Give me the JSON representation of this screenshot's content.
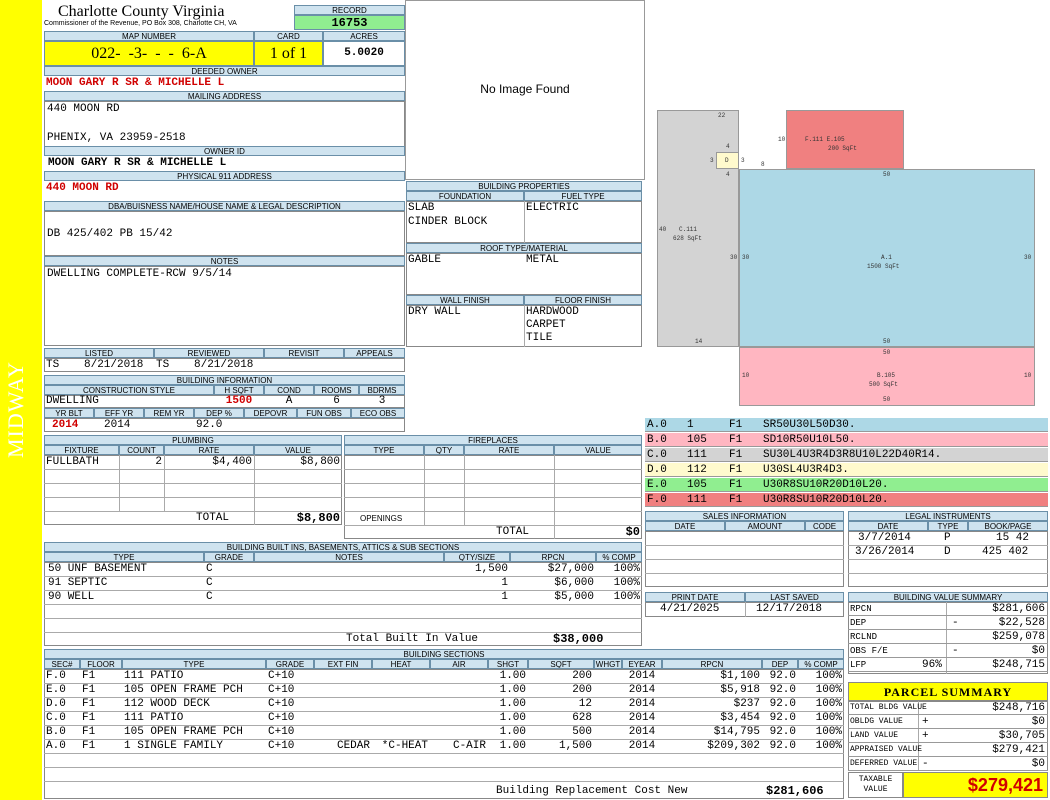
{
  "side_label": "MIDWAY",
  "county": {
    "title": "Charlotte County Virginia",
    "subtitle": "Commissioner of the Revenue, PO Box 308, Charlotte CH, VA"
  },
  "record": {
    "label": "RECORD",
    "value": "16753"
  },
  "map": {
    "label": "MAP NUMBER",
    "value": "022-  -3-  -  -  6-A"
  },
  "card": {
    "label": "CARD",
    "value": "1 of 1"
  },
  "acres": {
    "label": "ACRES",
    "value": "5.0020"
  },
  "deeded_owner": {
    "label": "DEEDED OWNER",
    "value": "MOON GARY R SR & MICHELLE L"
  },
  "mailing": {
    "label": "MAILING ADDRESS",
    "line1": "440 MOON RD",
    "line2": "PHENIX, VA 23959-2518"
  },
  "owner_id": {
    "label": "OWNER ID",
    "value": "MOON GARY R SR & MICHELLE L"
  },
  "physical": {
    "label": "PHYSICAL 911 ADDRESS",
    "value": "440 MOON RD"
  },
  "dba": {
    "label": "DBA/BUISNESS NAME/HOUSE NAME & LEGAL DESCRIPTION",
    "value": "DB 425/402 PB 15/42"
  },
  "notes": {
    "label": "NOTES",
    "value": "DWELLING COMPLETE-RCW 9/5/14"
  },
  "image_placeholder": "No Image Found",
  "listed": {
    "label": "LISTED",
    "by": "TS",
    "date": "8/21/2018"
  },
  "reviewed": {
    "label": "REVIEWED",
    "by": "TS",
    "date": "8/21/2018"
  },
  "revisit": {
    "label": "REVISIT"
  },
  "appeals": {
    "label": "APPEALS"
  },
  "building_info": {
    "label": "BUILDING INFORMATION",
    "h_style": "CONSTRUCTION STYLE",
    "h_sqft": "H SQFT",
    "h_cond": "COND",
    "h_rooms": "ROOMS",
    "h_bdrms": "BDRMS",
    "style": "DWELLING",
    "sqft": "1500",
    "cond": "A",
    "rooms": "6",
    "bdrms": "3",
    "h_yrblt": "YR BLT",
    "h_effyr": "EFF YR",
    "h_remyr": "REM YR",
    "h_dep": "DEP %",
    "h_depovr": "DEPOVR",
    "h_funobs": "FUN OBS",
    "h_ecoobs": "ECO OBS",
    "yrblt": "2014",
    "effyr": "2014",
    "dep": "92.0"
  },
  "building_properties": {
    "label": "BUILDING PROPERTIES",
    "h_foundation": "FOUNDATION",
    "h_fuel": "FUEL TYPE",
    "foundation1": "SLAB",
    "foundation2": "CINDER BLOCK",
    "fuel": "ELECTRIC",
    "h_roof": "ROOF TYPE/MATERIAL",
    "roof_type": "GABLE",
    "roof_material": "METAL",
    "h_wall": "WALL FINISH",
    "h_floor": "FLOOR FINISH",
    "wall": "DRY WALL",
    "floor1": "HARDWOOD",
    "floor2": "CARPET",
    "floor3": "TILE"
  },
  "plumbing": {
    "label": "PLUMBING",
    "h_fixture": "FIXTURE",
    "h_count": "COUNT",
    "h_rate": "RATE",
    "h_value": "VALUE",
    "fixture": "FULLBATH",
    "count": "2",
    "rate": "$4,400",
    "value": "$8,800",
    "total_label": "TOTAL",
    "total": "$8,800"
  },
  "fireplaces": {
    "label": "FIREPLACES",
    "h_type": "TYPE",
    "h_qty": "QTY",
    "h_rate": "RATE",
    "h_value": "VALUE",
    "openings_label": "OPENINGS",
    "total_label": "TOTAL",
    "total": "$0"
  },
  "sketch": {
    "n22": "22",
    "n10a": "10",
    "n4a": "4",
    "n3a": "3",
    "n3b": "3",
    "n8": "8",
    "n4b": "4",
    "box_d": "D",
    "f_label": "F.111  E.105",
    "f_sqft": "200 SqFt",
    "n50a": "50",
    "n40": "40",
    "n30a": "30",
    "n30b": "30",
    "n30c": "30",
    "c_label": "C.111",
    "c_sqft": "628 SqFt",
    "a_label": "A.1",
    "a_sqft": "1500 SqFt",
    "n14": "14",
    "n50b": "50",
    "n50c": "50",
    "n10b": "10",
    "n10c": "10",
    "b_label": "B.105",
    "b_sqft": "500 SqFt",
    "n50d": "50"
  },
  "legend_rows": [
    {
      "code": "A.0",
      "num": "1",
      "floor": "F1",
      "path": "SR50U30L50D30.",
      "color": "#add8e6"
    },
    {
      "code": "B.0",
      "num": "105",
      "floor": "F1",
      "path": "SD10R50U10L50.",
      "color": "#ffb6c1"
    },
    {
      "code": "C.0",
      "num": "111",
      "floor": "F1",
      "path": "SU30L4U3R4D3R8U10L22D40R14.",
      "color": "#d3d3d3"
    },
    {
      "code": "D.0",
      "num": "112",
      "floor": "F1",
      "path": "U30SL4U3R4D3.",
      "color": "#fffacd"
    },
    {
      "code": "E.0",
      "num": "105",
      "floor": "F1",
      "path": "U30R8SU10R20D10L20.",
      "color": "#90ee90"
    },
    {
      "code": "F.0",
      "num": "111",
      "floor": "F1",
      "path": "U30R8SU10R20D10L20.",
      "color": "#f08080"
    }
  ],
  "sales": {
    "label": "SALES INFORMATION",
    "h_date": "DATE",
    "h_amount": "AMOUNT",
    "h_code": "CODE"
  },
  "legal": {
    "label": "LEGAL INSTRUMENTS",
    "h_date": "DATE",
    "h_type": "TYPE",
    "h_book": "BOOK/PAGE",
    "rows": [
      {
        "date": "3/7/2014",
        "type": "P",
        "book": "15 42"
      },
      {
        "date": "3/26/2014",
        "type": "D",
        "book": "425 402"
      }
    ]
  },
  "print_date": {
    "label": "PRINT DATE",
    "value": "4/21/2025"
  },
  "last_saved": {
    "label": "LAST SAVED",
    "value": "12/17/2018"
  },
  "bvs": {
    "label": "BUILDING VALUE SUMMARY",
    "rpcn_l": "RPCN",
    "rpcn": "$281,606",
    "dep_l": "DEP",
    "dep_sign": "-",
    "dep": "$22,528",
    "rclnd_l": "RCLND",
    "rclnd": "$259,078",
    "obs_l": "OBS F/E",
    "obs_sign": "-",
    "obs": "$0",
    "lfr_l": "LFP",
    "lfr_pct": "96%",
    "lfr": "$248,715"
  },
  "parcel": {
    "label": "PARCEL SUMMARY",
    "bldg_l": "TOTAL BLDG VALUE",
    "bldg": "$248,716",
    "obldg_l": "OBLDG VALUE",
    "obldg_sign": "+",
    "obldg": "$0",
    "land_l": "LAND VALUE",
    "land_sign": "+",
    "land": "$30,705",
    "appr_l": "APPRAISED VALUE",
    "appr": "$279,421",
    "def_l": "DEFERRED VALUE",
    "def_sign": "-",
    "def": "$0",
    "tax_l1": "TAXABLE",
    "tax_l2": "VALUE",
    "tax": "$279,421"
  },
  "built_ins": {
    "label": "BUILDING BUILT INS, BASEMENTS, ATTICS & SUB SECTIONS",
    "h_type": "TYPE",
    "h_grade": "GRADE",
    "h_notes": "NOTES",
    "h_qty": "QTY/SIZE",
    "h_rpcn": "RPCN",
    "h_comp": "% COMP",
    "rows": [
      {
        "type": "50 UNF BASEMENT",
        "grade": "C",
        "qty": "1,500",
        "rpcn": "$27,000",
        "comp": "100%"
      },
      {
        "type": "91 SEPTIC",
        "grade": "C",
        "qty": "1",
        "rpcn": "$6,000",
        "comp": "100%"
      },
      {
        "type": "90 WELL",
        "grade": "C",
        "qty": "1",
        "rpcn": "$5,000",
        "comp": "100%"
      }
    ],
    "total_label": "Total Built In Value",
    "total": "$38,000"
  },
  "sections": {
    "label": "BUILDING SECTIONS",
    "h_sec": "SEC#",
    "h_floor": "FLOOR",
    "h_type": "TYPE",
    "h_grade": "GRADE",
    "h_extfin": "EXT FIN",
    "h_heat": "HEAT",
    "h_air": "AIR",
    "h_shgt": "SHGT",
    "h_sqft": "SQFT",
    "h_whgt": "WHGT",
    "h_eyear": "EYEAR",
    "h_rpcn": "RPCN",
    "h_dep": "DEP",
    "h_comp": "% COMP",
    "rows": [
      {
        "sec": "F.0",
        "floor": "F1",
        "type": "111 PATIO",
        "grade": "C+10",
        "extfin": "",
        "heat": "",
        "air": "",
        "shgt": "1.00",
        "sqft": "200",
        "eyear": "2014",
        "rpcn": "$1,100",
        "dep": "92.0",
        "comp": "100%"
      },
      {
        "sec": "E.0",
        "floor": "F1",
        "type": "105 OPEN FRAME PCH",
        "grade": "C+10",
        "extfin": "",
        "heat": "",
        "air": "",
        "shgt": "1.00",
        "sqft": "200",
        "eyear": "2014",
        "rpcn": "$5,918",
        "dep": "92.0",
        "comp": "100%"
      },
      {
        "sec": "D.0",
        "floor": "F1",
        "type": "112 WOOD DECK",
        "grade": "C+10",
        "extfin": "",
        "heat": "",
        "air": "",
        "shgt": "1.00",
        "sqft": "12",
        "eyear": "2014",
        "rpcn": "$237",
        "dep": "92.0",
        "comp": "100%"
      },
      {
        "sec": "C.0",
        "floor": "F1",
        "type": "111 PATIO",
        "grade": "C+10",
        "extfin": "",
        "heat": "",
        "air": "",
        "shgt": "1.00",
        "sqft": "628",
        "eyear": "2014",
        "rpcn": "$3,454",
        "dep": "92.0",
        "comp": "100%"
      },
      {
        "sec": "B.0",
        "floor": "F1",
        "type": "105 OPEN FRAME PCH",
        "grade": "C+10",
        "extfin": "",
        "heat": "",
        "air": "",
        "shgt": "1.00",
        "sqft": "500",
        "eyear": "2014",
        "rpcn": "$14,795",
        "dep": "92.0",
        "comp": "100%"
      },
      {
        "sec": "A.0",
        "floor": "F1",
        "type": "1 SINGLE FAMILY",
        "grade": "C+10",
        "extfin": "CEDAR",
        "heat": "*C-HEAT",
        "air": "C-AIR",
        "shgt": "1.00",
        "sqft": "1,500",
        "eyear": "2014",
        "rpcn": "$209,302",
        "dep": "92.0",
        "comp": "100%"
      }
    ],
    "total_label": "Building Replacement Cost New",
    "total": "$281,606"
  }
}
